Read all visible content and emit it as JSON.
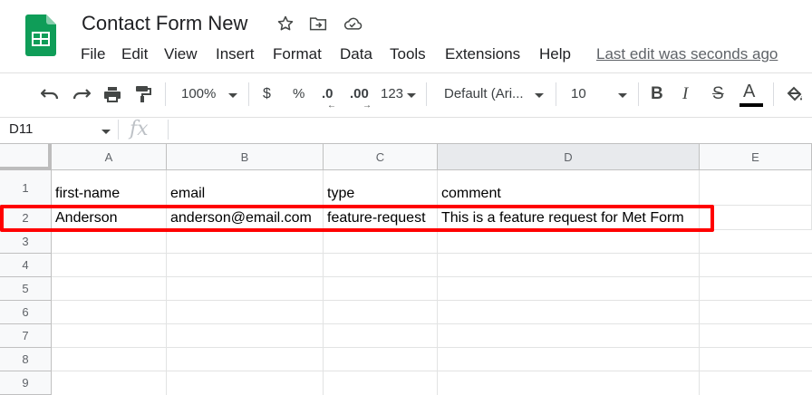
{
  "app": {
    "doc_title": "Contact Form New",
    "last_edit": "Last edit was seconds ago",
    "brand_green": "#0f9d58"
  },
  "menu": [
    "File",
    "Edit",
    "View",
    "Insert",
    "Format",
    "Data",
    "Tools",
    "Extensions",
    "Help"
  ],
  "toolbar": {
    "zoom": "100%",
    "currency": "$",
    "percent": "%",
    "decrease_decimal": ".0",
    "increase_decimal": ".00",
    "more_formats": "123",
    "font": "Default (Ari...",
    "font_size": "10",
    "bold": "B",
    "italic": "I",
    "strike": "S",
    "text_color": "A"
  },
  "formula_bar": {
    "name_box": "D11",
    "fx": "fx"
  },
  "columns": [
    "A",
    "B",
    "C",
    "D",
    "E"
  ],
  "rows": [
    "1",
    "2",
    "3",
    "4",
    "5",
    "6",
    "7",
    "8",
    "9"
  ],
  "cells": {
    "r1": [
      "first-name",
      "email",
      "type",
      "comment"
    ],
    "r2": [
      "Anderson",
      "anderson@email.com",
      "feature-request",
      "This is a feature request for Met Form"
    ]
  },
  "highlight_color": "#ff0000"
}
